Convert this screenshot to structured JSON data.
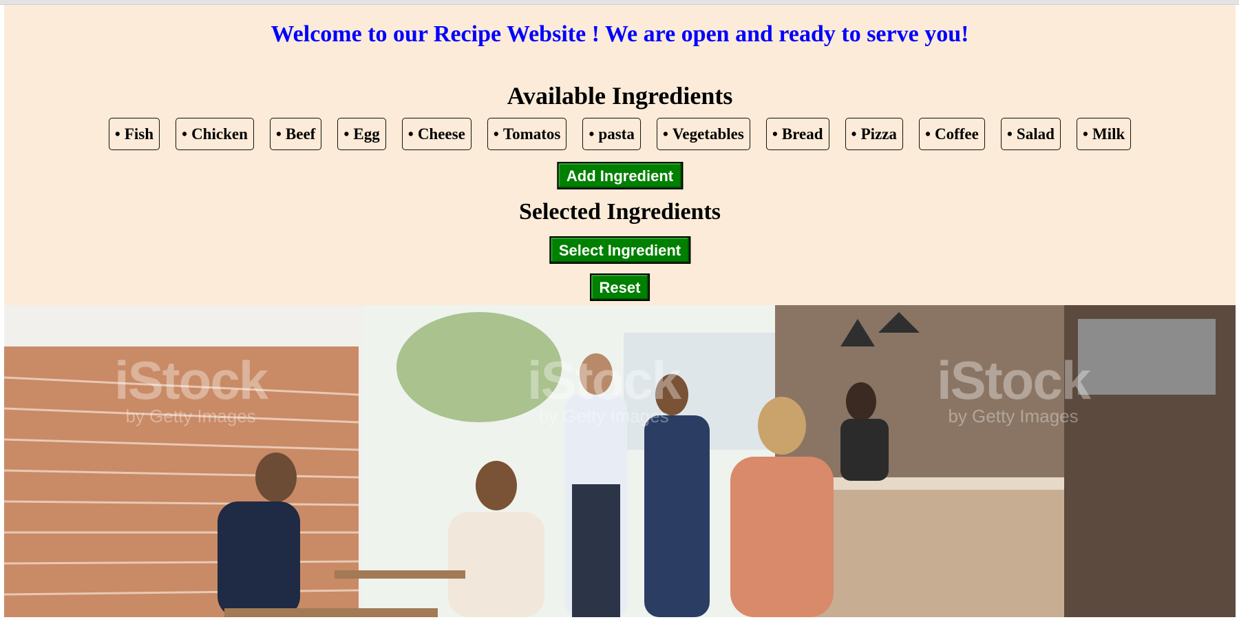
{
  "header": {
    "welcome": "Welcome to our Recipe Website ! We are open and ready to serve you!"
  },
  "available": {
    "title": "Available Ingredients",
    "bullet": "•",
    "items": [
      "Fish",
      "Chicken",
      "Beef",
      "Egg",
      "Cheese",
      "Tomatos",
      "pasta",
      "Vegetables",
      "Bread",
      "Pizza",
      "Coffee",
      "Salad",
      "Milk"
    ]
  },
  "buttons": {
    "add": "Add Ingredient",
    "select": "Select Ingredient",
    "reset": "Reset"
  },
  "selected": {
    "title": "Selected Ingredients"
  },
  "photo": {
    "watermark_brand": "iStock",
    "watermark_sub": "by Getty Images"
  },
  "colors": {
    "panel_bg": "#fbebd8",
    "welcome_text": "#0000ff",
    "button_bg": "#008000"
  }
}
